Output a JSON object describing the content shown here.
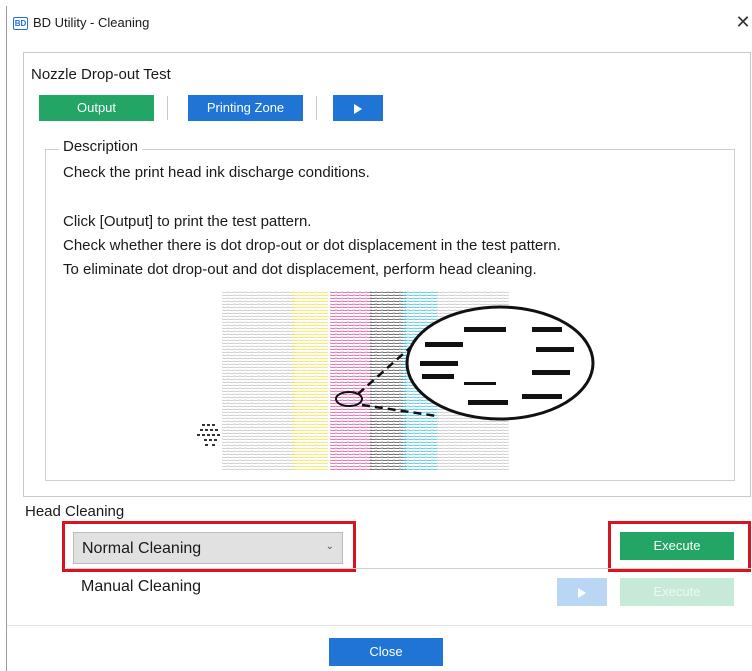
{
  "window": {
    "app_icon_text": "BD",
    "title": "BD Utility - Cleaning",
    "close_glyph": "✕"
  },
  "nozzle_test": {
    "title": "Nozzle Drop-out Test",
    "output_label": "Output",
    "printing_zone_label": "Printing Zone",
    "play_icon": "play-icon"
  },
  "description": {
    "legend": "Description",
    "line1": "Check the print head ink discharge conditions.",
    "line2": "Click [Output] to print the test pattern.",
    "line3": "Check whether there is dot drop-out or dot displacement in the test pattern.",
    "line4": "To eliminate dot drop-out and dot displacement, perform head cleaning."
  },
  "head_cleaning": {
    "title": "Head Cleaning",
    "mode_selected": "Normal Cleaning",
    "execute_label": "Execute",
    "manual_label": "Manual Cleaning",
    "manual_execute_label": "Execute"
  },
  "footer": {
    "close_label": "Close"
  },
  "colors": {
    "green": "#22a565",
    "blue": "#1f74d6",
    "highlight_red": "#d9131f",
    "cyan": "#4cc3e3",
    "magenta": "#e35aa5",
    "yellow": "#f2e35a",
    "black": "#1a1a1a"
  }
}
